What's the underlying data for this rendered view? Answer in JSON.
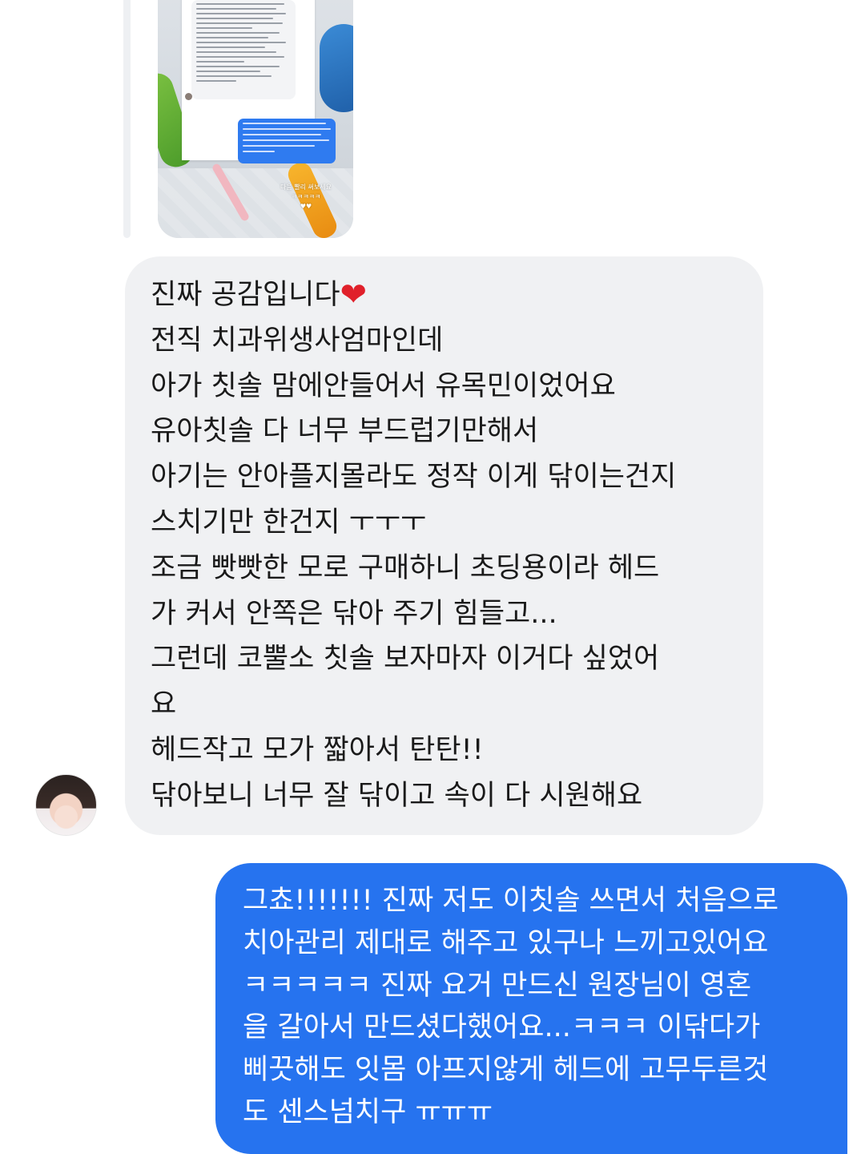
{
  "shared_story": {
    "caption_line1": "다음 빨리 써보세요",
    "caption_line2": "ㅋㅋㅋㅋㅋ",
    "caption_line3": "♥♥"
  },
  "incoming_message": {
    "lines": [
      "진짜 공감입니다",
      "전직 치과위생사엄마인데",
      "아가 칫솔 맘에안들어서 유목민이었어요",
      "유아칫솔 다 너무 부드럽기만해서",
      "아기는 안아플지몰라도 정작 이게 닦이는건지",
      "스치기만 한건지 ㅜㅜㅜ",
      "조금 빳빳한 모로 구매하니 초딩용이라 헤드",
      "가 커서 안쪽은 닦아 주기 힘들고...",
      "그런데 코뿔소 칫솔 보자마자 이거다 싶었어",
      "요",
      "헤드작고 모가 짧아서 탄탄!!",
      "닦아보니 너무 잘 닦이고 속이 다 시원해요"
    ],
    "heart_glyph": "❤"
  },
  "outgoing_message": {
    "lines": [
      "그쵸!!!!!!! 진짜 저도 이칫솔 쓰면서 처음으로",
      "치아관리 제대로 해주고 있구나 느끼고있어요",
      "ㅋㅋㅋㅋㅋ 진짜 요거 만드신 원장님이 영혼",
      "을 갈아서 만드셨다했어요...ㅋㅋㅋ 이닦다가",
      "삐끗해도 잇몸 아프지않게 헤드에 고무두른것",
      "도 센스넘치구 ㅠㅠㅠ"
    ]
  },
  "colors": {
    "incoming_bubble": "#f0f1f3",
    "outgoing_bubble": "#2673ef",
    "heart": "#e0202a"
  }
}
